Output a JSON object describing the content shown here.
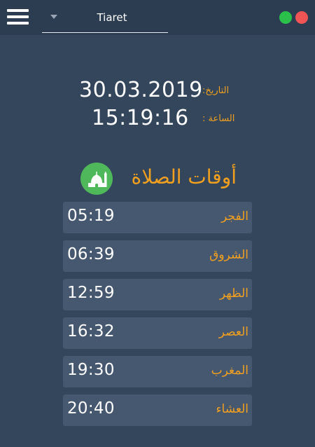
{
  "titlebar": {
    "city": "Tiaret",
    "menu_icon": "hamburger-menu-icon",
    "dropdown_icon": "chevron-down-icon",
    "controls": {
      "green": "#2bc04a",
      "red": "#f05454"
    }
  },
  "info": {
    "date_label": "التاريخ:",
    "date_value": "30.03.2019",
    "time_label": "الساعة :",
    "time_value": "15:19:16"
  },
  "section": {
    "title": "أوقات الصلاة",
    "icon": "mosque-icon"
  },
  "prayers": [
    {
      "name": "الفجر",
      "time": "05:19"
    },
    {
      "name": "الشروق",
      "time": "06:39"
    },
    {
      "name": "الظهر",
      "time": "12:59"
    },
    {
      "name": "العصر",
      "time": "16:32"
    },
    {
      "name": "المغرب",
      "time": "19:30"
    },
    {
      "name": "العشاء",
      "time": "20:40"
    }
  ],
  "colors": {
    "background": "#34465c",
    "titlebar": "#2c3c51",
    "row": "#465870",
    "accent": "#f2a01e",
    "icon_green": "#4fb85b"
  }
}
